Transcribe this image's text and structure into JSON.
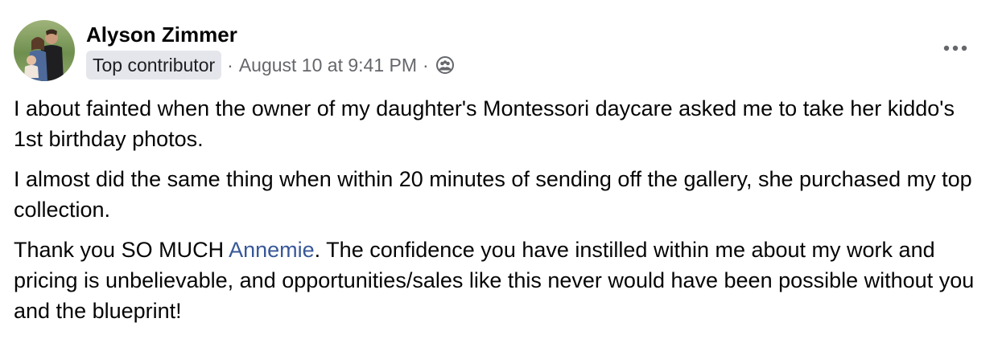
{
  "post": {
    "author": "Alyson Zimmer",
    "badge": "Top contributor",
    "separator": "·",
    "timestamp": "August 10 at 9:41 PM",
    "audience_icon": "group-icon",
    "more_icon": "more-options-icon",
    "body": {
      "p1": "I about fainted when the owner of my daughter's Montessori daycare asked me to take her kiddo's 1st birthday photos.",
      "p2": "I almost did the same thing when within 20 minutes of sending off the gallery, she purchased my top collection.",
      "p3_before": "Thank you SO MUCH ",
      "p3_mention": "Annemie",
      "p3_after": ". The confidence you have instilled within me about my work and pricing is unbelievable, and opportunities/sales like this never would have been possible without you and the blueprint!"
    }
  },
  "colors": {
    "mention": "#385898",
    "meta_text": "#65676b",
    "badge_bg": "#e4e6eb"
  }
}
